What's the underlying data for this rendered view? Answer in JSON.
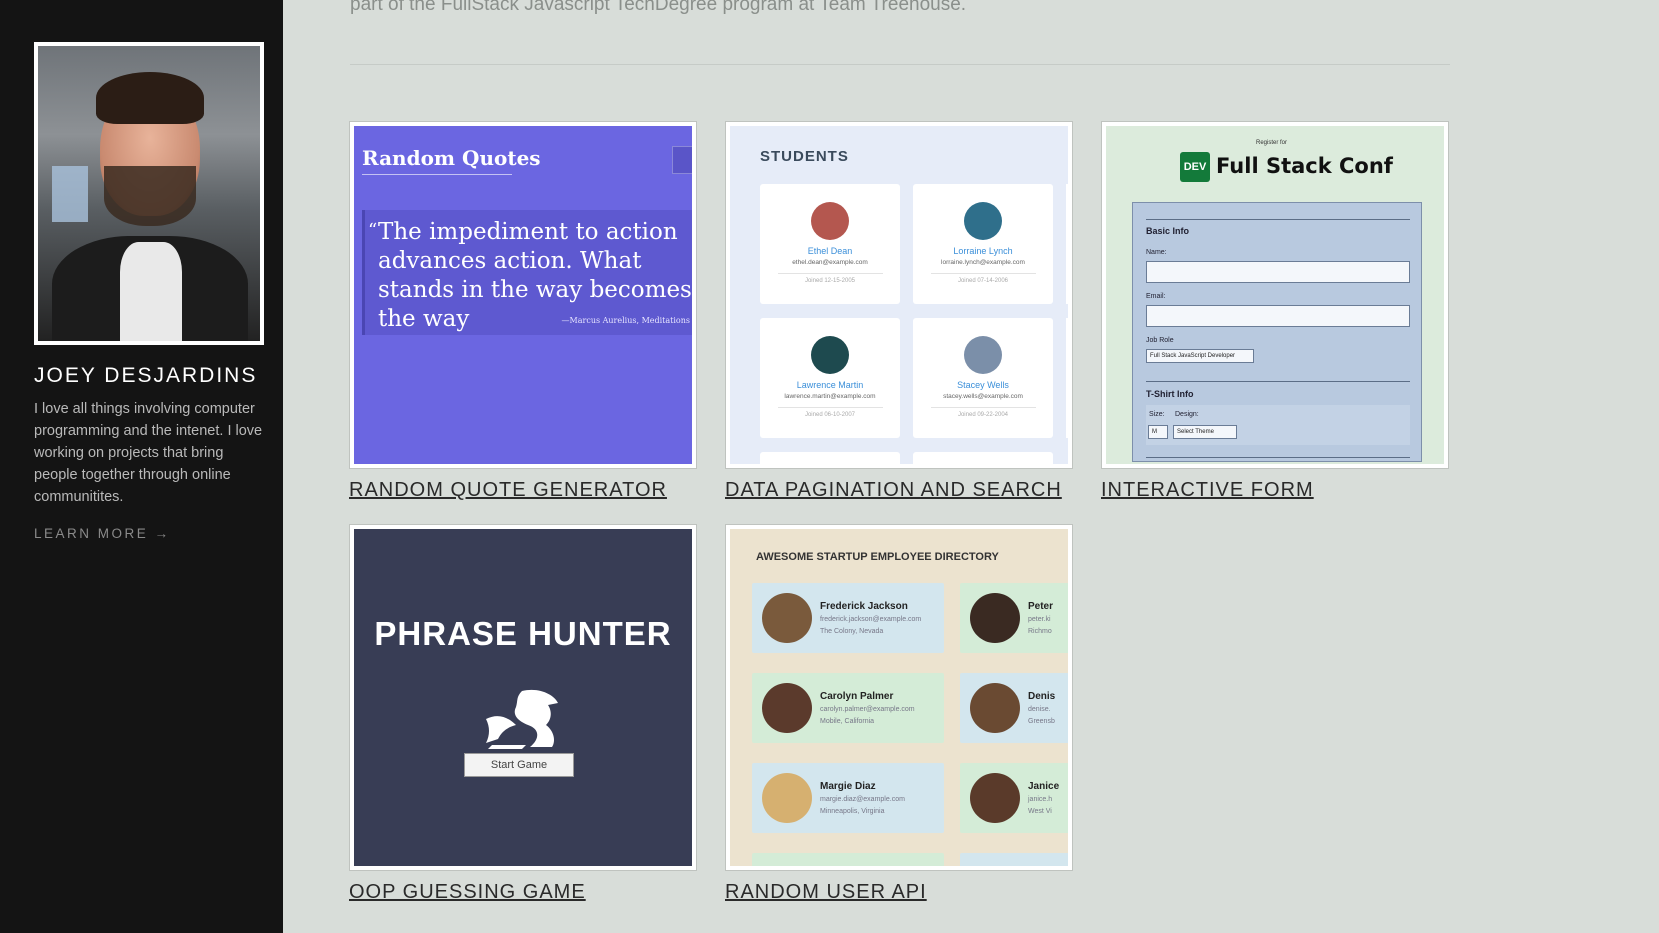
{
  "sidebar": {
    "name": "JOEY DESJARDINS",
    "bio": "I love all things involving computer programming and the intenet. I love working on projects that bring people together through online communitites.",
    "learn_more": "LEARN MORE →"
  },
  "main": {
    "intro": "part of the FullStack Javascript TechDegree program at Team Treehouse."
  },
  "projects": [
    {
      "title": "RANDOM QUOTE GENERATOR",
      "preview": {
        "logo": "Random Quotes",
        "quote": "The impediment to action advances action. What stands in the way becomes the way",
        "author": "—Marcus Aurelius, Meditations"
      }
    },
    {
      "title": "DATA PAGINATION AND SEARCH",
      "preview": {
        "heading": "STUDENTS",
        "students": [
          {
            "name": "Ethel Dean",
            "email": "ethel.dean@example.com",
            "joined": "Joined 12-15-2005",
            "color": "#b4574f"
          },
          {
            "name": "Lorraine Lynch",
            "email": "lorraine.lynch@example.com",
            "joined": "Joined 07-14-2006",
            "color": "#2f6f8b"
          },
          {
            "name": "Lawrence Martin",
            "email": "lawrence.martin@example.com",
            "joined": "Joined 06-10-2007",
            "color": "#1e4a4f"
          },
          {
            "name": "Stacey Wells",
            "email": "stacey.wells@example.com",
            "joined": "Joined 09-22-2004",
            "color": "#7b8fa9"
          }
        ]
      }
    },
    {
      "title": "INTERACTIVE FORM",
      "preview": {
        "register": "Register for",
        "badge": "DEV",
        "conf": "Full Stack Conf",
        "basic_info": "Basic Info",
        "name_label": "Name:",
        "email_label": "Email:",
        "job_label": "Job Role",
        "job_value": "Full Stack JavaScript Developer",
        "tshirt": "T-Shirt Info",
        "size_label": "Size:",
        "design_label": "Design:",
        "size_value": "M",
        "design_value": "Select Theme"
      }
    },
    {
      "title": "OOP GUESSING GAME",
      "preview": {
        "heading": "PHRASE HUNTER",
        "button": "Start Game"
      }
    },
    {
      "title": "RANDOM USER API",
      "preview": {
        "heading": "AWESOME STARTUP EMPLOYEE DIRECTORY",
        "employees": [
          {
            "name": "Frederick Jackson",
            "email": "frederick.jackson@example.com",
            "location": "The Colony, Nevada",
            "color": "#7a5a3c"
          },
          {
            "name": "Peter",
            "email": "peter.ki",
            "location": "Richmo",
            "color": "#3a2a22"
          },
          {
            "name": "Carolyn Palmer",
            "email": "carolyn.palmer@example.com",
            "location": "Mobile, California",
            "color": "#5b3a2c"
          },
          {
            "name": "Denis",
            "email": "denise.",
            "location": "Greensb",
            "color": "#6a4a32"
          },
          {
            "name": "Margie Diaz",
            "email": "margie.diaz@example.com",
            "location": "Minneapolis, Virginia",
            "color": "#d6b070"
          },
          {
            "name": "Janice",
            "email": "janice.h",
            "location": "West Vi",
            "color": "#5a3a2a"
          }
        ]
      }
    }
  ]
}
